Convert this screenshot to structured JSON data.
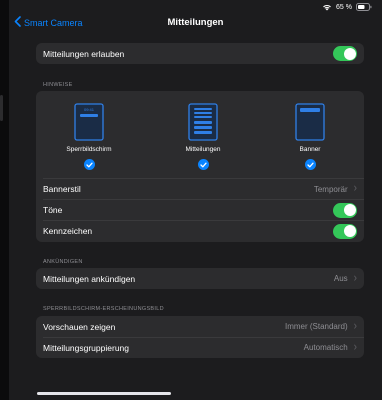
{
  "status_bar": {
    "wifi_icon": "wifi-icon",
    "battery_percent": "65 %",
    "battery_icon": "battery-icon"
  },
  "nav": {
    "back_label": "Smart Camera",
    "title": "Mitteilungen"
  },
  "allow": {
    "label": "Mitteilungen erlauben",
    "on": true
  },
  "hinweise": {
    "header": "HINWEISE",
    "styles": [
      {
        "caption": "Sperrbildschirm",
        "checked": true,
        "preview_time": "09:41"
      },
      {
        "caption": "Mitteilungen",
        "checked": true
      },
      {
        "caption": "Banner",
        "checked": true
      }
    ],
    "bannerstil": {
      "label": "Bannerstil",
      "value": "Temporär"
    },
    "toene": {
      "label": "Töne",
      "on": true
    },
    "kennzeichen": {
      "label": "Kennzeichen",
      "on": true
    }
  },
  "ankuendigen": {
    "header": "ANKÜNDIGEN",
    "row": {
      "label": "Mitteilungen ankündigen",
      "value": "Aus"
    }
  },
  "lockscreen": {
    "header": "SPERRBILDSCHIRM-ERSCHEINUNGSBILD",
    "preview": {
      "label": "Vorschauen zeigen",
      "value": "Immer (Standard)"
    },
    "grouping": {
      "label": "Mitteilungsgruppierung",
      "value": "Automatisch"
    }
  },
  "colors": {
    "accent": "#0a84ff",
    "toggle_on": "#34c759",
    "group_bg": "#2c2c2e",
    "screen_bg": "#1c1c1e"
  }
}
